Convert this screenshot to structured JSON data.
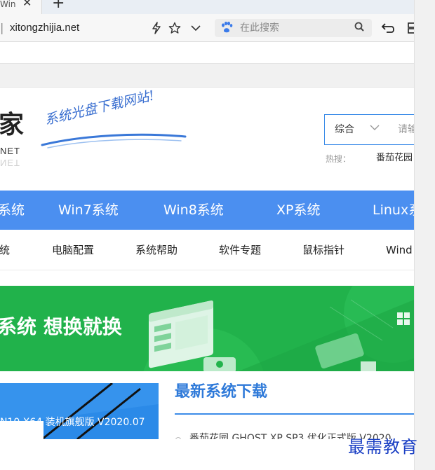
{
  "browser": {
    "tab_title": "Win",
    "tab_close_glyph": "✕",
    "new_tab_glyph": "+",
    "address_prefix": "|",
    "url": "xitongzhijia.net",
    "search_placeholder": "在此搜索",
    "icons": [
      "lightning-icon",
      "star-icon",
      "chevron-down-icon",
      "paw-icon",
      "search-icon",
      "back-icon",
      "extensions-icon"
    ]
  },
  "site": {
    "logo_char": "家",
    "logo_sub": "NET",
    "slogan": "系统光盘下载网站!",
    "search": {
      "type_label": "综合",
      "input_placeholder": "请输"
    },
    "hot": {
      "label": "热搜：",
      "item": "番茄花园"
    },
    "nav": [
      "系统",
      "Win7系统",
      "Win8系统",
      "XP系统",
      "Linux系"
    ],
    "subnav": [
      "统",
      "电脑配置",
      "系统帮助",
      "软件专题",
      "鼠标指针",
      "Wind"
    ],
    "banner_text": "系统 想换就换",
    "thumb_caption": "N10 X64 装机旗舰版 V2020.07",
    "section_title": "最新系统下载",
    "list": [
      "番茄花园 GHOST XP SP3 优化正式版 V2020"
    ]
  },
  "watermark": "最需教育",
  "colors": {
    "brand_blue": "#4b8ff0",
    "banner_green": "#21b24b",
    "section_blue": "#2f7ad9",
    "watermark_blue": "#1a3fc4"
  }
}
